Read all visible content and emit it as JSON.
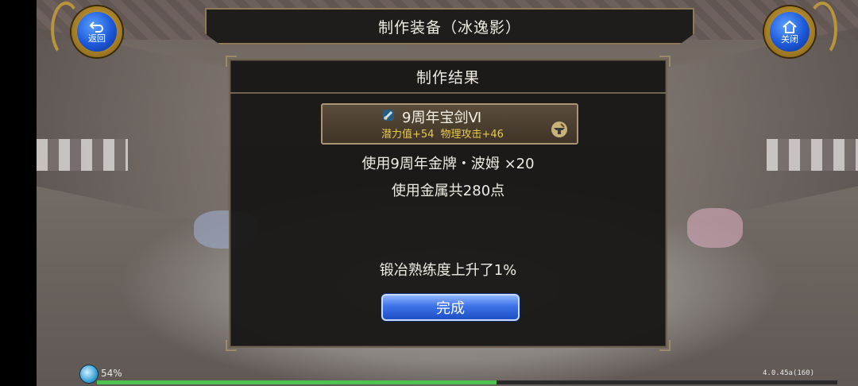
{
  "header": {
    "title": "制作装备（冰逸影）",
    "back_label": "返回",
    "close_label": "关闭",
    "back_icon": "return-arrow-icon",
    "close_icon": "home-icon"
  },
  "dialog": {
    "title": "制作结果",
    "item": {
      "name": "9周年宝剑Ⅵ",
      "icon": "sword-icon",
      "stats": [
        "潜力值+54",
        "物理攻击+46"
      ],
      "badge_icon": "anvil-icon"
    },
    "material_line": "使用9周年金牌・波姆 ×20",
    "metal_line": "使用金属共280点",
    "proficiency_line": "锻冶熟练度上升了1%",
    "confirm_label": "完成"
  },
  "status": {
    "progress_label": "54%",
    "progress_value": 0.54,
    "version": "4.0.45a(160)"
  },
  "colors": {
    "accent_blue": "#2f66de",
    "gold": "#b8953a",
    "stat_yellow": "#e8c94a"
  }
}
